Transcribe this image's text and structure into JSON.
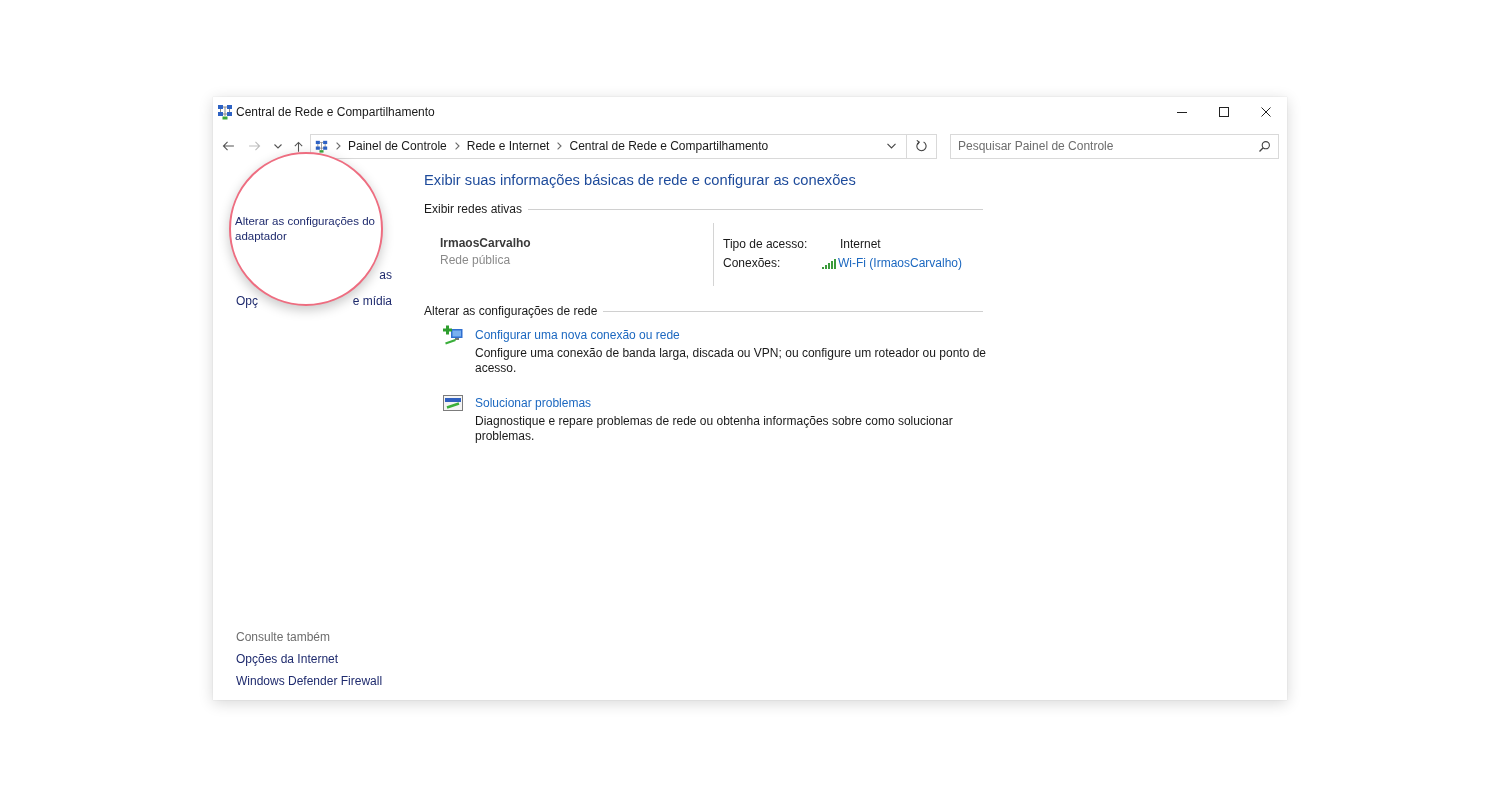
{
  "window": {
    "title": "Central de Rede e Compartilhamento"
  },
  "navigation": {
    "buttons": [
      {
        "kind": "back",
        "disabled": false
      },
      {
        "kind": "forward",
        "disabled": true
      },
      {
        "kind": "recent",
        "disabled": false
      },
      {
        "kind": "up",
        "disabled": false
      }
    ],
    "breadcrumbs": [
      "Painel de Controle",
      "Rede e Internet",
      "Central de Rede e Compartilhamento"
    ],
    "search": {
      "placeholder": "Pesquisar Painel de Controle"
    }
  },
  "sidebar": {
    "links": [
      {
        "visible_end": "as"
      },
      {
        "visible_start": "Opç",
        "visible_end": "e mídia"
      }
    ],
    "see_also": {
      "heading": "Consulte também",
      "links": [
        "Opções da Internet",
        "Windows Defender Firewall"
      ]
    }
  },
  "magnifier": {
    "link": "Alterar as configurações do adaptador"
  },
  "main": {
    "heading": "Exibir suas informações básicas de rede e configurar as conexões",
    "active_networks": {
      "title": "Exibir redes ativas",
      "networks": [
        {
          "name": "IrmaosCarvalho",
          "category": "Rede pública",
          "access_label": "Tipo de acesso:",
          "access": "Internet",
          "connections_label": "Conexões:",
          "connection": "Wi-Fi (IrmaosCarvalho)"
        }
      ]
    },
    "change_settings": {
      "title": "Alterar as configurações de rede",
      "tasks": [
        {
          "kind": "new-connection",
          "link": "Configurar uma nova conexão ou rede",
          "description": "Configure uma conexão de banda larga, discada ou VPN; ou configure um roteador ou ponto de acesso."
        },
        {
          "kind": "troubleshoot",
          "link": "Solucionar problemas",
          "description": "Diagnostique e repare problemas de rede ou obtenha informações sobre como solucionar problemas."
        }
      ]
    }
  }
}
